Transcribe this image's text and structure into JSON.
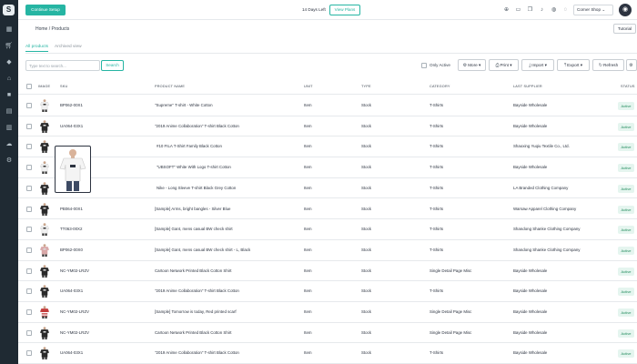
{
  "topbar": {
    "setup_label": "Continue Setup",
    "days_left": "14 Days Left",
    "plans_label": "View Plans",
    "store_name": "Corner Shop ⌄"
  },
  "breadcrumb": "Home / Products",
  "tutorial_label": "Tutorial",
  "tabs": [
    {
      "label": "All products",
      "active": true
    },
    {
      "label": "Archived view",
      "active": false
    }
  ],
  "search": {
    "placeholder": "Type text to search...",
    "button_label": "Search"
  },
  "toolbar": {
    "only_active": "Only Active",
    "more": "More",
    "print": "Print",
    "import": "Import",
    "export": "Export",
    "refresh": "Refresh"
  },
  "columns": {
    "image": "IMAGE",
    "sku": "SKU",
    "name": "PRODUCT NAME",
    "unit": "UNIT",
    "type": "TYPE",
    "category": "CATEGORY",
    "supplier": "LAST SUPPLIER",
    "status": "STATUS"
  },
  "rows": [
    {
      "sku": "BP062-00X1",
      "name": "\"Supreme\" T-shirt - White Cotton",
      "unit": "Item",
      "type": "Stock",
      "category": "T-Shirts",
      "supplier": "Bayside Wholesale",
      "status": "Active",
      "thumb": "white"
    },
    {
      "sku": "UA064-03X1",
      "name": "\"2019 Anime Collaboration\" T-shirt Black Cotton",
      "unit": "Item",
      "type": "Stock",
      "category": "T-Shirts",
      "supplier": "Bayside Wholesale",
      "status": "Active",
      "thumb": "black"
    },
    {
      "sku": "",
      "name": "#10 FILA T-Shirt Family Black Cotton",
      "unit": "Item",
      "type": "Stock",
      "category": "T-Shirts",
      "supplier": "Shaoxing Yuqiu Textile Co., Ltd.",
      "status": "Active",
      "thumb": "black"
    },
    {
      "sku": "",
      "name": "\"UBSOFT\" White With Logo T-shirt Cotton",
      "unit": "Item",
      "type": "Stock",
      "category": "T-Shirts",
      "supplier": "Bayside Wholesale",
      "status": "Active",
      "thumb": "white"
    },
    {
      "sku": "",
      "name": "Nike - Long Sleeve T-shirt Black Grey Cotton",
      "unit": "Item",
      "type": "Stock",
      "category": "T-Shirts",
      "supplier": "LA Branded Clothing Company",
      "status": "Active",
      "thumb": "black"
    },
    {
      "sku": "PB064-00X1",
      "name": "[Sample] Arms, bright bangles - Silver Blue",
      "unit": "Item",
      "type": "Stock",
      "category": "T-Shirts",
      "supplier": "Warsaw Apparel Clothing Company",
      "status": "Active",
      "thumb": "black"
    },
    {
      "sku": "TT063-00X2",
      "name": "[Sample] Gant, mens casual BW check shirt",
      "unit": "Item",
      "type": "Stock",
      "category": "T-Shirts",
      "supplier": "Shandong Shanke Clothing Company",
      "status": "Active",
      "thumb": "white"
    },
    {
      "sku": "BP062-00X0",
      "name": "[Sample] Gant, mens casual BW check shirt - L, Black",
      "unit": "Item",
      "type": "Stock",
      "category": "T-Shirts",
      "supplier": "Shandong Shanke Clothing Company",
      "status": "Active",
      "thumb": "pink"
    },
    {
      "sku": "NC-YM02-LRZV",
      "name": "Cartoon Network Printed Black Cotton Shirt",
      "unit": "Item",
      "type": "Stock",
      "category": "Single Detail Page Misc",
      "supplier": "Bayside Wholesale",
      "status": "Active",
      "thumb": "black"
    },
    {
      "sku": "UA064-03X1",
      "name": "\"2019 Anime Collaboration\" T-shirt Black Cotton",
      "unit": "Item",
      "type": "Stock",
      "category": "T-Shirts",
      "supplier": "Bayside Wholesale",
      "status": "Active",
      "thumb": "black"
    },
    {
      "sku": "NC-YM02-LRZV",
      "name": "[Sample] Tomorrow is today, Red printed scarf",
      "unit": "Item",
      "type": "Stock",
      "category": "Single Detail Page Misc",
      "supplier": "Bayside Wholesale",
      "status": "Active",
      "thumb": "red"
    },
    {
      "sku": "NC-YM02-LRZV",
      "name": "Cartoon Network Printed Black Cotton Shirt",
      "unit": "Item",
      "type": "Stock",
      "category": "Single Detail Page Misc",
      "supplier": "Bayside Wholesale",
      "status": "Active",
      "thumb": "black"
    },
    {
      "sku": "UA064-03X1",
      "name": "\"2019 Anime Collaboration\" T-shirt Black Cotton",
      "unit": "Item",
      "type": "Stock",
      "category": "T-Shirts",
      "supplier": "Bayside Wholesale",
      "status": "Active",
      "thumb": "black"
    }
  ],
  "colors": {
    "accent": "#26b5a3",
    "sidebar": "#1f2a33",
    "active_badge_bg": "#e5f5ef",
    "active_badge_text": "#1f8a5a"
  },
  "icons": {
    "sidebar": [
      "dashboard-icon",
      "cart-icon",
      "tag-icon",
      "home-icon",
      "box-icon",
      "book-icon",
      "chart-icon",
      "cloud-icon",
      "gear-icon"
    ],
    "topbar": [
      "add-icon",
      "chat-icon",
      "copy-icon",
      "bell-icon",
      "globe-icon",
      "help-icon"
    ]
  }
}
